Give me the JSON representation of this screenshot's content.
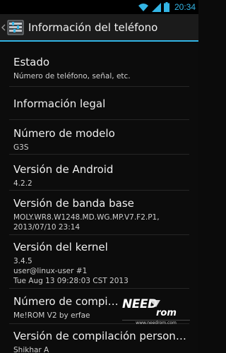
{
  "status_bar": {
    "time": "20:34",
    "icons": [
      "wifi-icon",
      "signal-icon",
      "battery-icon"
    ]
  },
  "action_bar": {
    "title": "Información del teléfono",
    "icon": "settings-icon"
  },
  "items": [
    {
      "title": "Estado",
      "summary": [
        "Número de teléfono, señal, etc."
      ]
    },
    {
      "title": "Información legal",
      "summary": []
    },
    {
      "title": "Número de modelo",
      "summary": [
        "G3S"
      ]
    },
    {
      "title": "Versión de Android",
      "summary": [
        "4.2.2"
      ]
    },
    {
      "title": "Versión de banda base",
      "summary": [
        "MOLY.WR8.W1248.MD.WG.MP.V7.F2.P1,",
        "2013/07/10 23:14"
      ]
    },
    {
      "title": "Versión del kernel",
      "summary": [
        "3.4.5",
        "user@linux-user #1",
        "Tue Aug 13 09:28:03 CST 2013"
      ]
    },
    {
      "title": "Número de compilación",
      "summary": [
        "Me!ROM V2 by erfae"
      ]
    },
    {
      "title": "Versión de compilación personalizada",
      "summary": [
        "Shikhar A"
      ]
    }
  ],
  "watermark": {
    "text": "NEED ROM",
    "url": "www.needrom.com"
  }
}
